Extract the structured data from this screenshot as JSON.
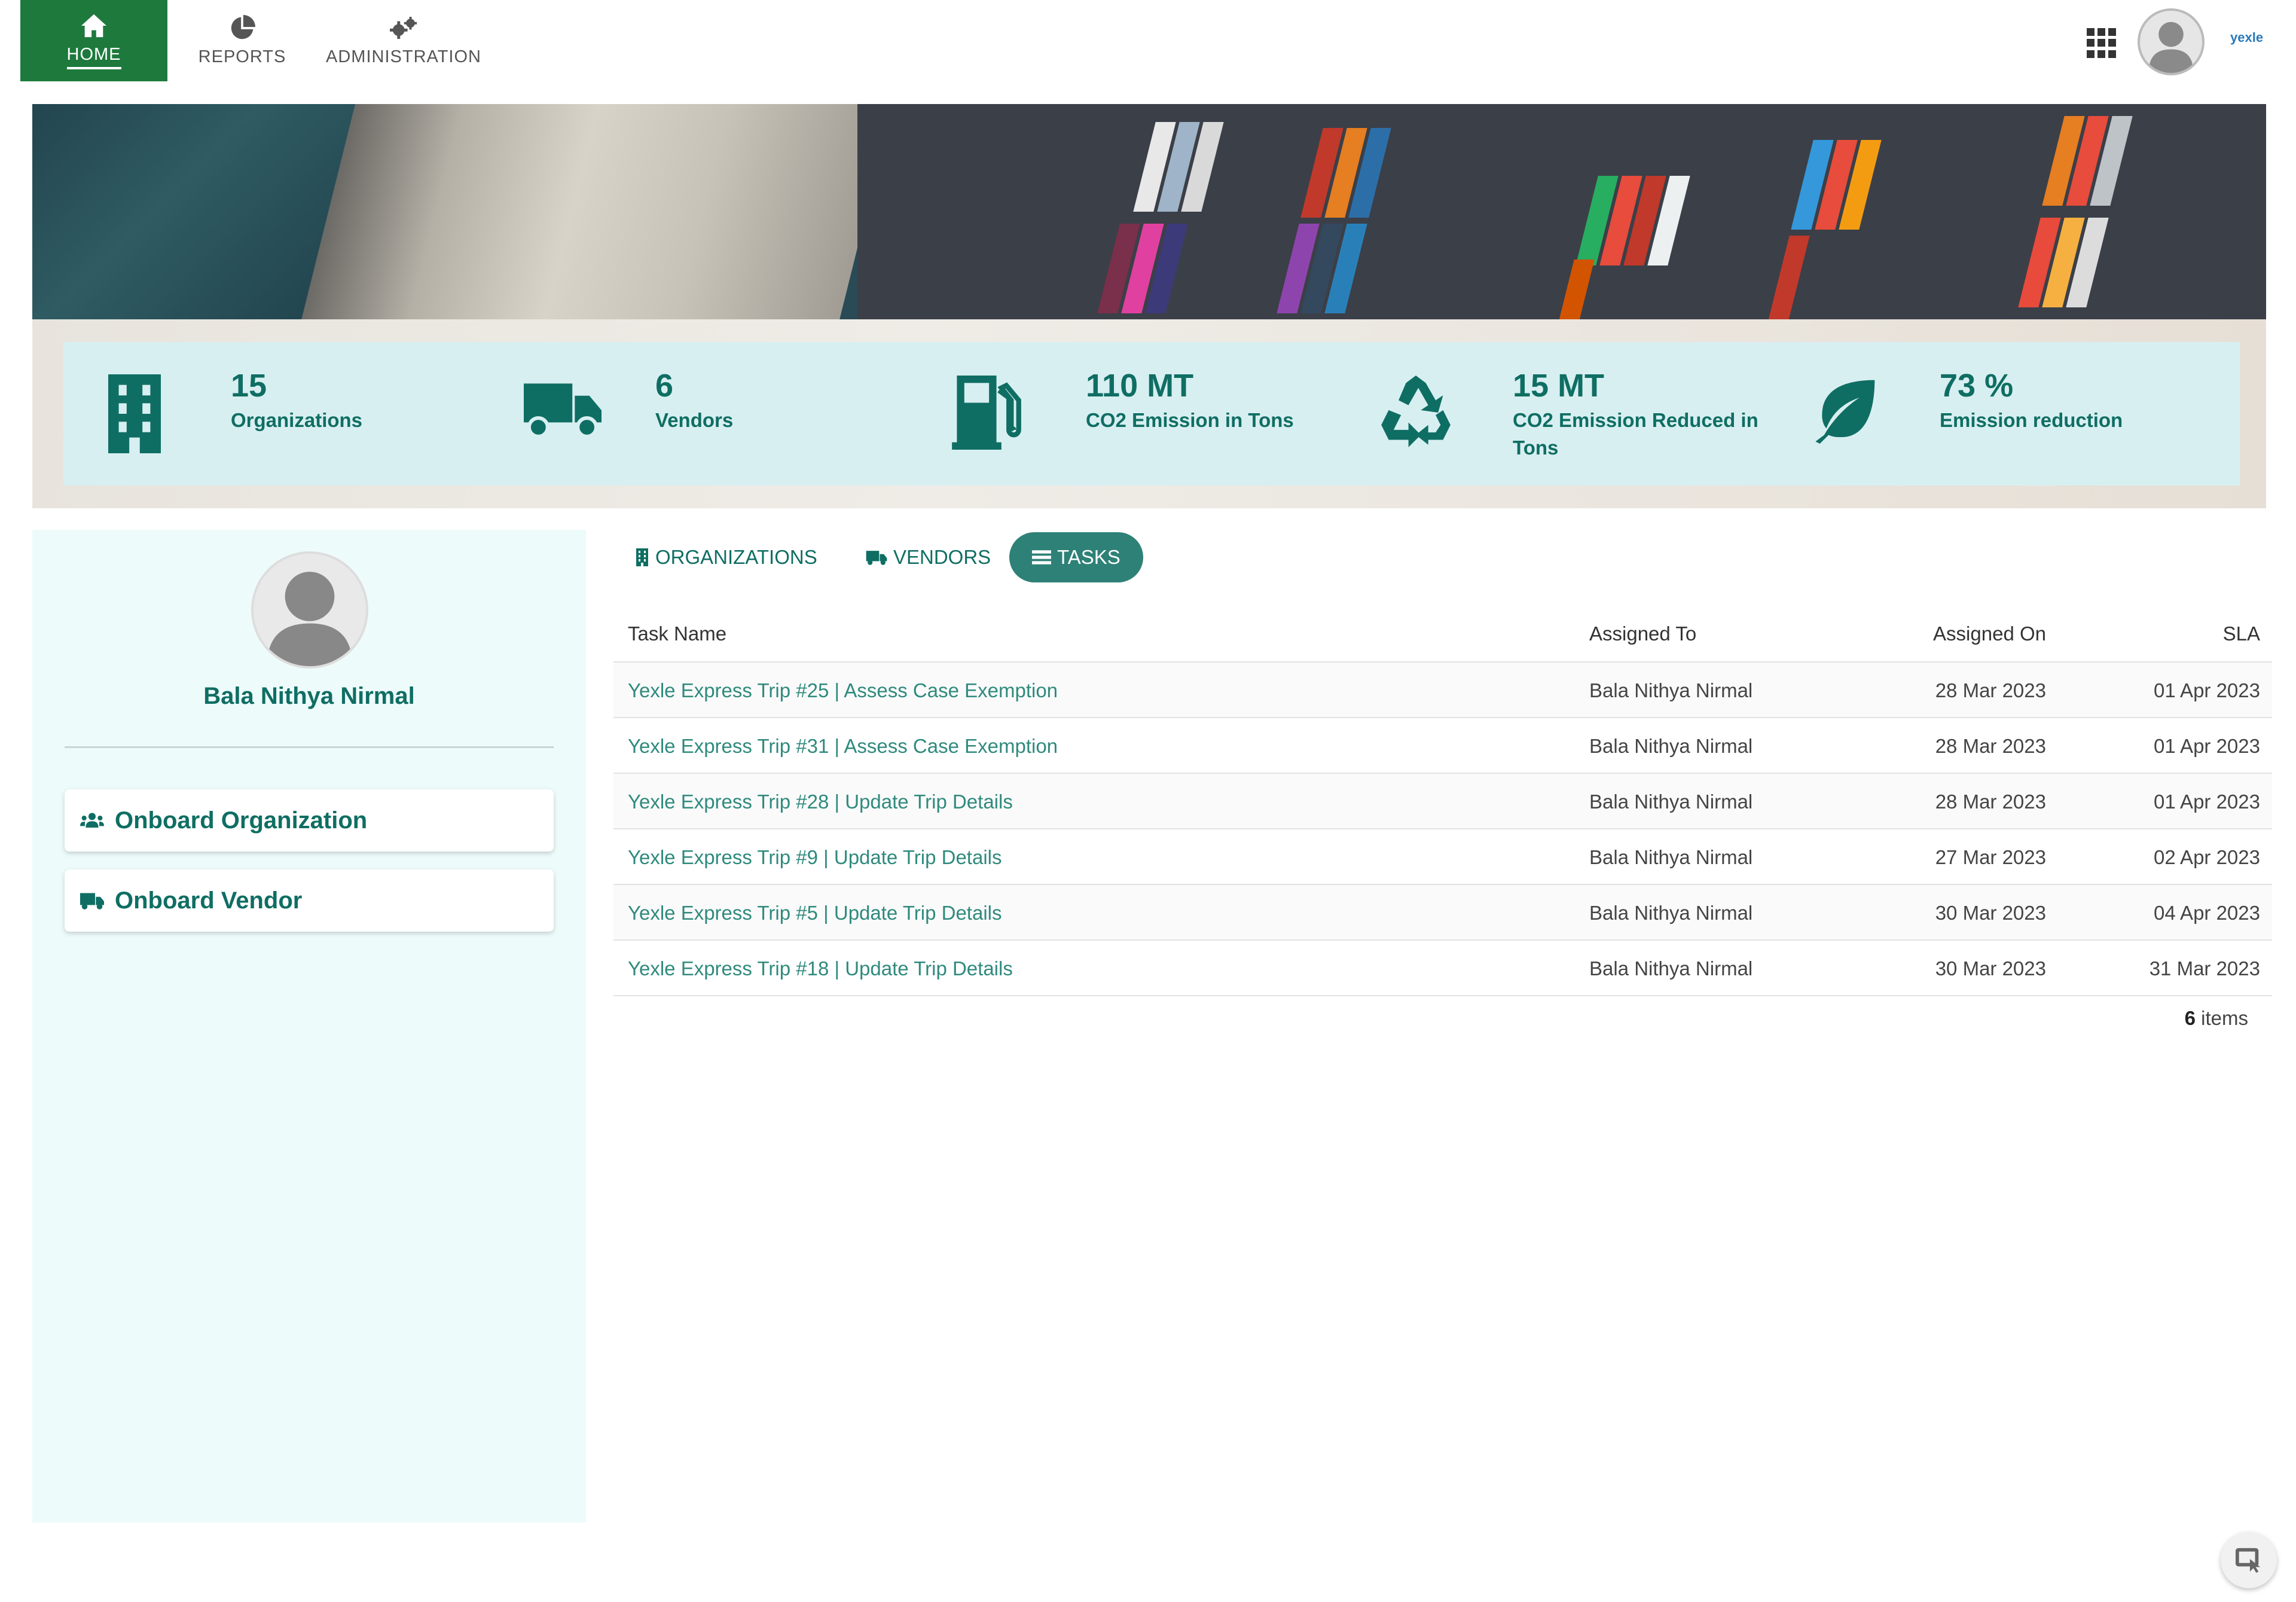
{
  "nav": {
    "home": "HOME",
    "reports": "REPORTS",
    "administration": "ADMINISTRATION",
    "brand": "yexle"
  },
  "stats": [
    {
      "value": "15",
      "caption": "Organizations",
      "icon": "building-icon"
    },
    {
      "value": "6",
      "caption": "Vendors",
      "icon": "truck-icon"
    },
    {
      "value": "110  MT",
      "caption": "CO2 Emission in Tons",
      "icon": "fuel-pump-icon"
    },
    {
      "value": "15  MT",
      "caption": "CO2 Emission Reduced in Tons",
      "icon": "recycle-icon"
    },
    {
      "value": "73 %",
      "caption": "Emission reduction",
      "icon": "leaf-icon"
    }
  ],
  "profile": {
    "name": "Bala Nithya Nirmal",
    "onboard_org": "Onboard Organization",
    "onboard_vendor": "Onboard Vendor"
  },
  "tabs": [
    {
      "label": "ORGANIZATIONS",
      "active": false
    },
    {
      "label": "VENDORS",
      "active": false
    },
    {
      "label": "TASKS",
      "active": true
    }
  ],
  "table": {
    "headers": [
      "Task Name",
      "Assigned To",
      "Assigned On",
      "SLA"
    ],
    "rows": [
      [
        "Yexle Express Trip #25 | Assess Case Exemption",
        "Bala Nithya Nirmal",
        "28 Mar 2023",
        "01 Apr 2023"
      ],
      [
        "Yexle Express Trip #31 | Assess Case Exemption",
        "Bala Nithya Nirmal",
        "28 Mar 2023",
        "01 Apr 2023"
      ],
      [
        "Yexle Express Trip #28 | Update Trip Details",
        "Bala Nithya Nirmal",
        "28 Mar 2023",
        "01 Apr 2023"
      ],
      [
        "Yexle Express Trip #9 | Update Trip Details",
        "Bala Nithya Nirmal",
        "27 Mar 2023",
        "02 Apr 2023"
      ],
      [
        "Yexle Express Trip #5 | Update Trip Details",
        "Bala Nithya Nirmal",
        "30 Mar 2023",
        "04 Apr 2023"
      ],
      [
        "Yexle Express Trip #18 | Update Trip Details",
        "Bala Nithya Nirmal",
        "30 Mar 2023",
        "31 Mar 2023"
      ]
    ],
    "count": "6",
    "count_suffix": " items"
  },
  "colors": {
    "nav_active": "#1d7a3c",
    "accent": "#0f6e63",
    "tab_active": "#2e8177",
    "link": "#2f8a7d",
    "stats_bg": "#d8eff1",
    "panel_bg": "#eefbfb"
  }
}
